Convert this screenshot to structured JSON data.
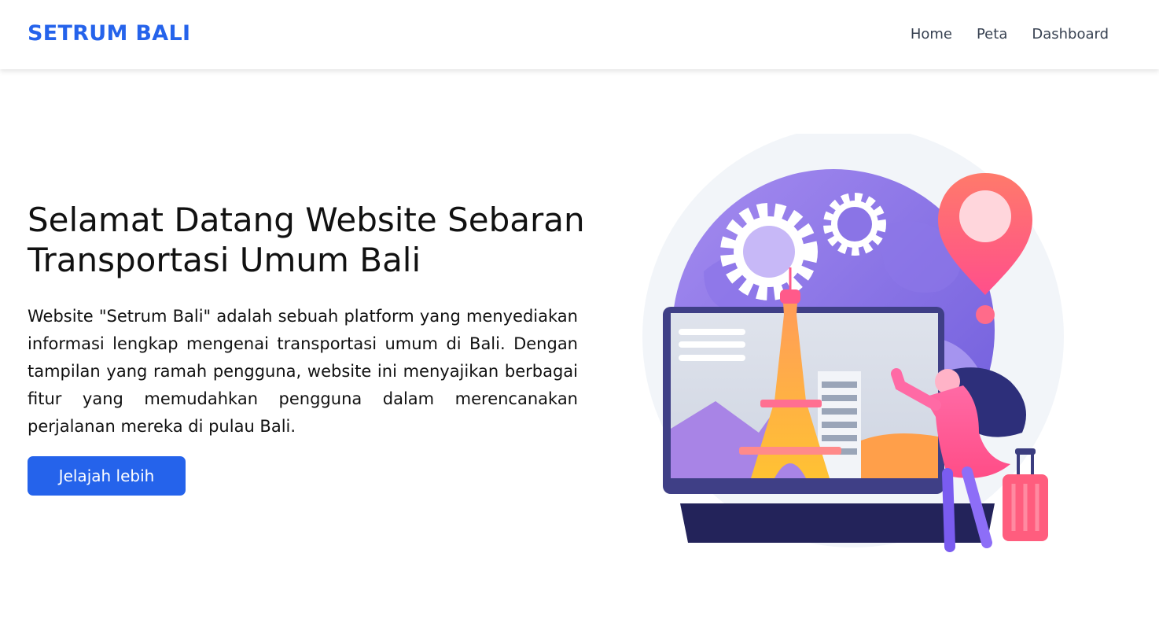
{
  "navbar": {
    "brand": "SETRUM BALI",
    "links": [
      "Home",
      "Peta",
      "Dashboard"
    ]
  },
  "hero": {
    "title": "Selamat Datang Website Sebaran Transportasi Umum Bali",
    "description": "Website \"Setrum Bali\" adalah sebuah platform yang menyediakan informasi lengkap mengenai transportasi umum di Bali. Dengan tampilan yang ramah pengguna, website ini menyajikan berbagai fitur yang memudahkan pengguna dalam merencanakan perjalanan mereka di pulau Bali.",
    "cta_label": "Jelajah lebih"
  },
  "colors": {
    "accent": "#2563eb",
    "nav_text": "#374151",
    "text": "#111111"
  }
}
